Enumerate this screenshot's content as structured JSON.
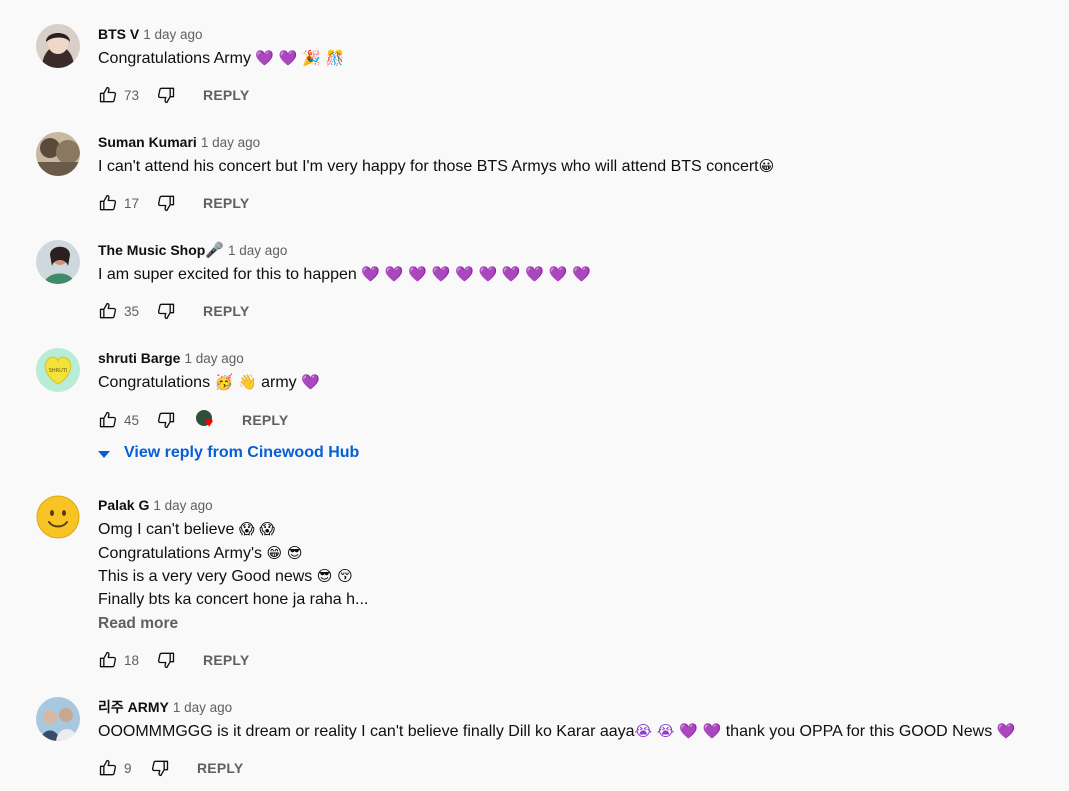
{
  "colors": {
    "accent": "#065fd4",
    "heart_purple": "#8e3bd1",
    "muted": "#606060"
  },
  "comments": [
    {
      "author": "BTS V",
      "time": "1 day ago",
      "lines": [
        "Congratulations Army"
      ],
      "emoji_tail": "💜 💜 🎉 🎊",
      "likes": "73",
      "reply_label": "REPLY"
    },
    {
      "author": "Suman Kumari",
      "time": "1 day ago",
      "lines": [
        "I can't attend his concert but I'm very happy for those BTS Armys who will attend BTS concert"
      ],
      "emoji_tail": "😀",
      "likes": "17",
      "reply_label": "REPLY"
    },
    {
      "author": "The Music Shop",
      "author_icon": "🎤",
      "time": "1 day ago",
      "lines": [
        "I am super excited for this to happen"
      ],
      "emoji_tail": "💜 💜 💜 💜 💜 💜 💜 💜 💜 💜",
      "likes": "35",
      "reply_label": "REPLY"
    },
    {
      "author": "shruti Barge",
      "time": "1 day ago",
      "text_a": "Congratulations",
      "emoji_a": "🥳 👋",
      "text_b": "army",
      "emoji_b": "💜",
      "likes": "45",
      "reply_label": "REPLY",
      "view_reply": "View reply from Cinewood Hub",
      "avatar_text": "SHRUTI"
    },
    {
      "author": "Palak G",
      "time": "1 day ago",
      "line1_text": "Omg I can't believe",
      "line1_emoji": "😱 😱",
      "line2_text": "Congratulations Army's",
      "line2_emoji": "😁 😎",
      "line3_text": "This is a very very Good news",
      "line3_emoji": "😎 😚",
      "line4_text": "Finally bts  ka concert hone ja raha h...",
      "read_more": "Read more",
      "likes": "18",
      "reply_label": "REPLY"
    },
    {
      "author": "리주 ARMY",
      "time": "1 day ago",
      "text_a": "OOOMMMGGG is it dream or reality I can't believe finally Dill ko Karar aaya",
      "emoji_a": "😭 😭 💜 💜",
      "text_b": "thank you OPPA for this GOOD News",
      "emoji_b": "💜",
      "likes": "9",
      "reply_label": "REPLY"
    }
  ]
}
